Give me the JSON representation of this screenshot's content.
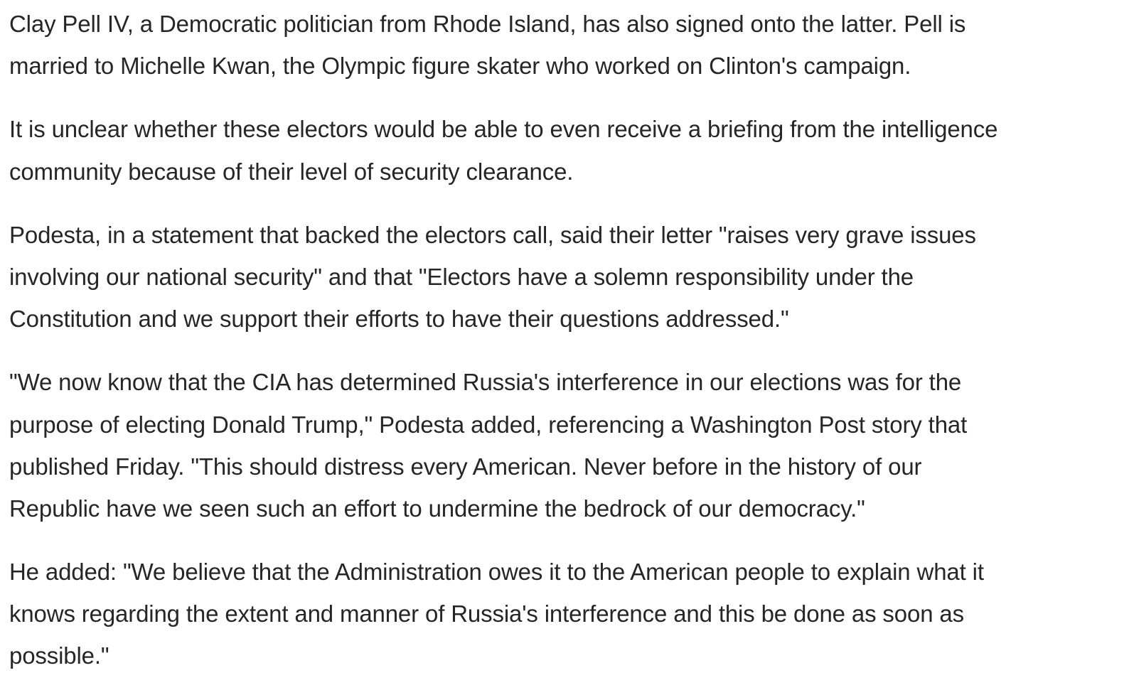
{
  "article": {
    "paragraphs": [
      {
        "lines": [
          "Clay Pell IV, a Democratic politician from Rhode Island, has also signed onto the latter. Pell is",
          "married to Michelle Kwan, the Olympic figure skater who worked on Clinton's campaign."
        ]
      },
      {
        "lines": [
          "It is unclear whether these electors would be able to even receive a briefing from the intelligence",
          "community because of their level of security clearance."
        ]
      },
      {
        "lines": [
          "Podesta, in a statement that backed the electors call, said their letter \"raises very grave issues",
          "involving our national security\" and that \"Electors have a solemn responsibility under the",
          "Constitution and we support their efforts to have their questions addressed.\""
        ]
      },
      {
        "lines": [
          "\"We now know that the CIA has determined Russia's interference in our elections was for the",
          "purpose of electing Donald Trump,\" Podesta added, referencing a Washington Post story that",
          "published Friday. \"This should distress every American. Never before in the history of our",
          "Republic have we seen such an effort to undermine the bedrock of our democracy.\""
        ]
      },
      {
        "lines": [
          "He added: \"We believe that the Administration owes it to the American people to explain what it",
          "knows regarding the extent and manner of Russia's interference and this be done as soon as",
          "possible.\""
        ]
      }
    ]
  }
}
